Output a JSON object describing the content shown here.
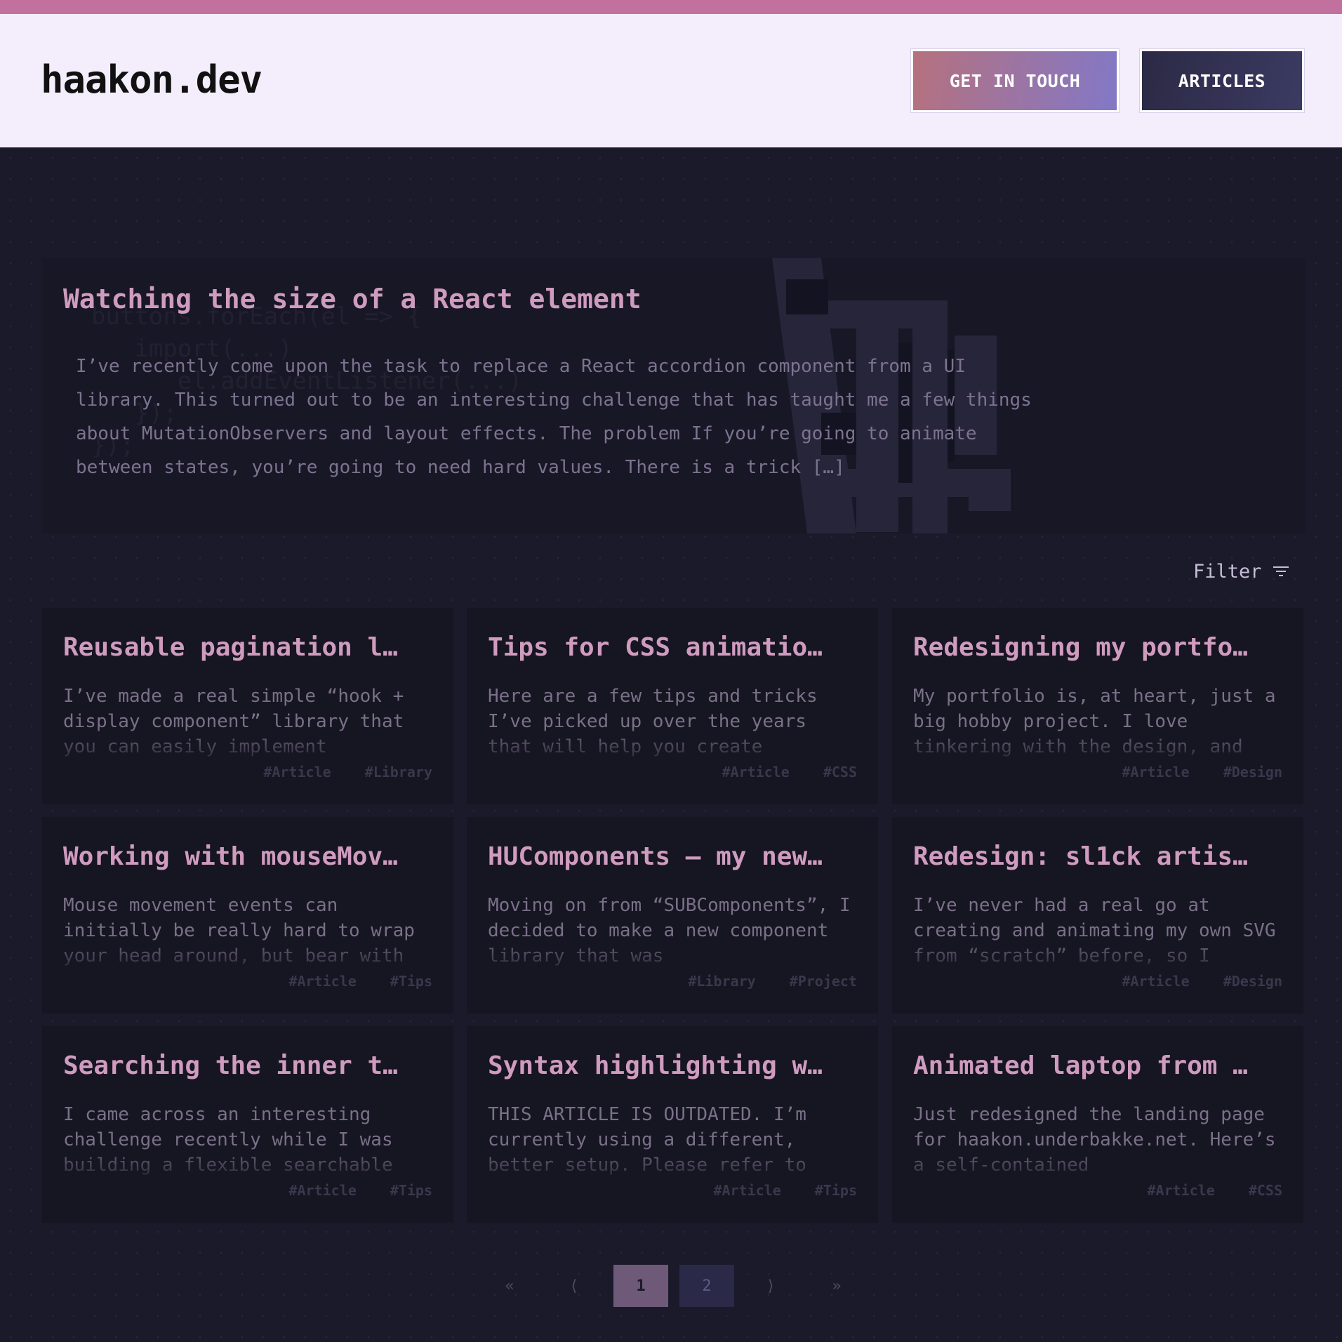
{
  "header": {
    "logo": "haakon.dev",
    "contact_button": "GET IN TOUCH",
    "articles_button": "ARTICLES"
  },
  "featured": {
    "title": "Watching the size of a React element",
    "excerpt": "I’ve recently come upon the task to replace a React accordion component from a UI library. This turned out to be an interesting challenge that has taught me a few things about MutationObservers and layout effects. The problem If you’re going to animate between states, you’re going to need hard values. There is a trick […]"
  },
  "filter": {
    "label": "Filter",
    "icon": "filter-icon"
  },
  "cards": [
    {
      "title": "Reusable pagination l…",
      "excerpt": "I’ve made a real simple “hook + display component” library that you can easily implement",
      "tags": [
        "#Article",
        "#Library"
      ]
    },
    {
      "title": "Tips for CSS animatio…",
      "excerpt": "Here are a few tips and tricks I’ve picked up over the years that will help you create",
      "tags": [
        "#Article",
        "#CSS"
      ]
    },
    {
      "title": "Redesigning my portfo…",
      "excerpt": "My portfolio is, at heart, just a big hobby project. I love tinkering with the design, and",
      "tags": [
        "#Article",
        "#Design"
      ]
    },
    {
      "title": "Working with mouseMov…",
      "excerpt": "Mouse movement events can initially be really hard to wrap your head around, but bear with",
      "tags": [
        "#Article",
        "#Tips"
      ]
    },
    {
      "title": "HUComponents – my new…",
      "excerpt": "Moving on from “SUBComponents”, I decided to make a new component library that was",
      "tags": [
        "#Library",
        "#Project"
      ]
    },
    {
      "title": "Redesign: sl1ck artis…",
      "excerpt": "I’ve never had a real go at creating and animating my own SVG from “scratch” before, so I",
      "tags": [
        "#Article",
        "#Design"
      ]
    },
    {
      "title": "Searching the inner t…",
      "excerpt": "I came across an interesting challenge recently while I was building a flexible searchable",
      "tags": [
        "#Article",
        "#Tips"
      ]
    },
    {
      "title": "Syntax highlighting w…",
      "excerpt": "THIS ARTICLE IS OUTDATED. I’m currently using a different, better setup. Please refer to",
      "tags": [
        "#Article",
        "#Tips"
      ]
    },
    {
      "title": "Animated laptop from …",
      "excerpt": "Just redesigned the landing page for haakon.underbakke.net. Here’s a self-contained",
      "tags": [
        "#Article",
        "#CSS"
      ]
    }
  ],
  "pagination": {
    "first": "«",
    "prev": "⟨",
    "page1": "1",
    "page2": "2",
    "next": "⟩",
    "last": "»",
    "current_page": 1
  },
  "colors": {
    "background": "#1b1a2a",
    "accent_pink": "#cf9bbf",
    "header_bg": "#f4eefc",
    "top_strip": "#c2719f"
  }
}
